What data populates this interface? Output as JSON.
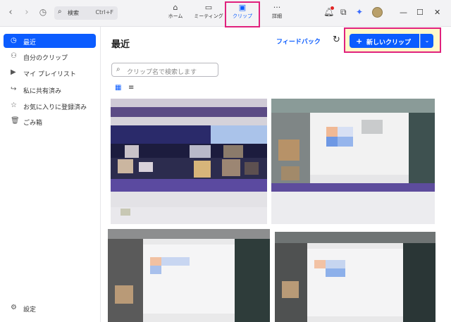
{
  "topbar": {
    "back_icon": "chevron-left",
    "forward_icon": "chevron-right",
    "history_icon": "clock",
    "search_placeholder": "検索",
    "search_shortcut": "Ctrl+F",
    "tabs": [
      {
        "label": "ホーム",
        "icon": "home"
      },
      {
        "label": "ミーティング",
        "icon": "video"
      },
      {
        "label": "クリップ",
        "icon": "clip-play"
      },
      {
        "label": "詳細",
        "icon": "more"
      }
    ]
  },
  "sidebar": {
    "items": [
      {
        "label": "最近",
        "icon": "clock",
        "active": true
      },
      {
        "label": "自分のクリップ",
        "icon": "person"
      },
      {
        "label": "マイ プレイリスト",
        "icon": "playlist"
      },
      {
        "label": "私に共有済み",
        "icon": "share"
      },
      {
        "label": "お気に入りに登録済み",
        "icon": "star"
      },
      {
        "label": "ごみ箱",
        "icon": "trash"
      }
    ],
    "settings_label": "設定"
  },
  "main": {
    "title": "最近",
    "feedback_label": "フィードバック",
    "new_clip_label": "新しいクリップ",
    "search_placeholder": "クリップ名で検索します"
  },
  "colors": {
    "accent": "#0b5cff",
    "highlight_border": "#e0217d",
    "highlight_fill": "#fff9c9"
  }
}
